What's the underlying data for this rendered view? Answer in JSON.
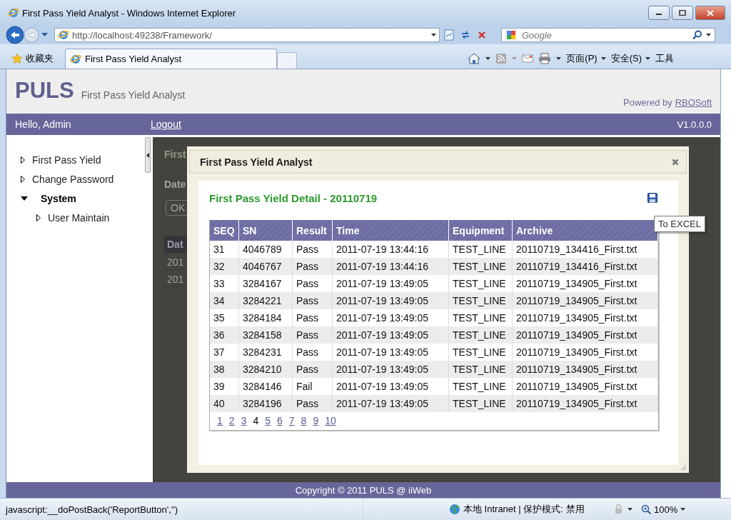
{
  "window": {
    "title": "First Pass Yield Analyst - Windows Internet Explorer"
  },
  "address_bar": {
    "url": "http://localhost:49238/Framework/",
    "search_placeholder": "Google"
  },
  "command_bar": {
    "favorites": "收藏夹",
    "tabs": [
      {
        "label": "First Pass Yield Analyst",
        "selected": true
      }
    ],
    "commands": [
      "页面(P)",
      "安全(S)",
      "工具"
    ]
  },
  "header": {
    "logo": "PULS",
    "subtitle": "First Pass Yield Analyst",
    "powered_by": "Powered by",
    "powered_link": "RBOSoft"
  },
  "nav_bar": {
    "greeting": "Hello, Admin",
    "logout": "Logout",
    "version": "V1.0.0.0"
  },
  "sidebar": {
    "items": [
      {
        "label": "First Pass Yield",
        "expanded": false
      },
      {
        "label": "Change Password",
        "expanded": false
      },
      {
        "label": "System",
        "expanded": true,
        "children": [
          {
            "label": "User Maintain",
            "expanded": false
          }
        ]
      }
    ]
  },
  "background_page": {
    "heading": "First",
    "date_label": "Date",
    "ok_button": "OK",
    "table_header": "Dat",
    "cells": [
      "201",
      "201"
    ]
  },
  "dialog": {
    "title": "First Pass Yield Analyst",
    "heading": "First Pass Yield Detail - 20110719",
    "tooltip": "To EXCEL",
    "table": {
      "columns": [
        "SEQ",
        "SN",
        "Result",
        "Time",
        "Equipment",
        "Archive"
      ],
      "rows": [
        [
          "31",
          "4046789",
          "Pass",
          "2011-07-19 13:44:16",
          "TEST_LINE",
          "20110719_134416_First.txt"
        ],
        [
          "32",
          "4046767",
          "Pass",
          "2011-07-19 13:44:16",
          "TEST_LINE",
          "20110719_134416_First.txt"
        ],
        [
          "33",
          "3284167",
          "Pass",
          "2011-07-19 13:49:05",
          "TEST_LINE",
          "20110719_134905_First.txt"
        ],
        [
          "34",
          "3284221",
          "Pass",
          "2011-07-19 13:49:05",
          "TEST_LINE",
          "20110719_134905_First.txt"
        ],
        [
          "35",
          "3284184",
          "Pass",
          "2011-07-19 13:49:05",
          "TEST_LINE",
          "20110719_134905_First.txt"
        ],
        [
          "36",
          "3284158",
          "Pass",
          "2011-07-19 13:49:05",
          "TEST_LINE",
          "20110719_134905_First.txt"
        ],
        [
          "37",
          "3284231",
          "Pass",
          "2011-07-19 13:49:05",
          "TEST_LINE",
          "20110719_134905_First.txt"
        ],
        [
          "38",
          "3284210",
          "Pass",
          "2011-07-19 13:49:05",
          "TEST_LINE",
          "20110719_134905_First.txt"
        ],
        [
          "39",
          "3284146",
          "Fail",
          "2011-07-19 13:49:05",
          "TEST_LINE",
          "20110719_134905_First.txt"
        ],
        [
          "40",
          "3284196",
          "Pass",
          "2011-07-19 13:49:05",
          "TEST_LINE",
          "20110719_134905_First.txt"
        ]
      ]
    },
    "pages": [
      {
        "label": "1",
        "selected": false
      },
      {
        "label": "2",
        "selected": false
      },
      {
        "label": "3",
        "selected": false
      },
      {
        "label": "4",
        "selected": true
      },
      {
        "label": "5",
        "selected": false
      },
      {
        "label": "6",
        "selected": false
      },
      {
        "label": "7",
        "selected": false
      },
      {
        "label": "8",
        "selected": false
      },
      {
        "label": "9",
        "selected": false
      },
      {
        "label": "10",
        "selected": false
      }
    ]
  },
  "footer": {
    "copyright": "Copyright © 2011 PULS @ iiWeb"
  },
  "status_bar": {
    "text": "javascript:__doPostBack('ReportButton','')",
    "zone": "本地 Intranet | 保护模式: 禁用",
    "zoom": "100%"
  }
}
